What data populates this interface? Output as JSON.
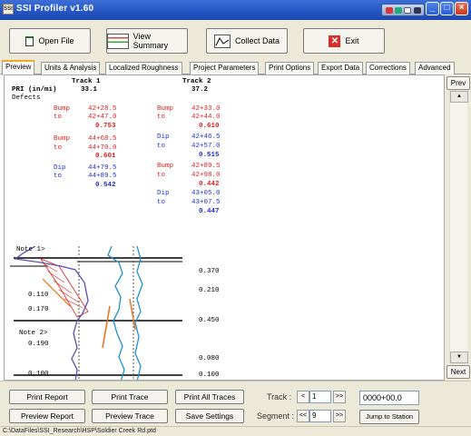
{
  "window": {
    "title": "SSI Profiler v1.60",
    "icon_text": "SSI"
  },
  "toolbar": {
    "open_label": "Open File",
    "view_label": "View Summary",
    "collect_label": "Collect Data",
    "exit_label": "Exit"
  },
  "tabs": [
    {
      "label": "Preview"
    },
    {
      "label": "Units & Analysis"
    },
    {
      "label": "Localized Roughness"
    },
    {
      "label": "Project Parameters"
    },
    {
      "label": "Print Options"
    },
    {
      "label": "Export Data"
    },
    {
      "label": "Corrections"
    },
    {
      "label": "Advanced"
    }
  ],
  "report": {
    "track1_header": "Track 1",
    "track2_header": "Track 2",
    "pri_label": "PRI (in/mi)",
    "track1_pri": "33.1",
    "track2_pri": "37.2",
    "defects_label": "Defects",
    "track1_defects": [
      {
        "type": "Bump",
        "from": "42+28.5",
        "to": "42+47.0",
        "value": "0.753"
      },
      {
        "type": "Bump",
        "from": "44+68.5",
        "to": "44+70.0",
        "value": "0.601"
      },
      {
        "type": "Dip",
        "from": "44+79.5",
        "to": "44+89.5",
        "value": "0.542"
      }
    ],
    "track2_defects": [
      {
        "type": "Bump",
        "from": "42+33.0",
        "to": "42+44.0",
        "value": "0.610"
      },
      {
        "type": "Dip",
        "from": "42+46.5",
        "to": "42+57.0",
        "value": "0.515"
      },
      {
        "type": "Bump",
        "from": "42+89.5",
        "to": "42+98.0",
        "value": "0.442"
      },
      {
        "type": "Dip",
        "from": "43+05.0",
        "to": "43+07.5",
        "value": "0.447"
      }
    ],
    "to_label": "to"
  },
  "trace": {
    "note1": "Note 1>",
    "note2": "Note 2>",
    "left_values": [
      "0.110",
      "0.170",
      "0.190",
      "0.100"
    ],
    "right_values": [
      "0.370",
      "0.210",
      "0.450",
      "0.080",
      "0.100"
    ]
  },
  "nav": {
    "prev_label": "Prev",
    "next_label": "Next"
  },
  "bottom": {
    "print_report": "Print Report",
    "print_trace": "Print Trace",
    "print_all_traces": "Print All Traces",
    "preview_report": "Preview Report",
    "preview_trace": "Preview Trace",
    "save_settings": "Save Settings",
    "track_label": "Track :",
    "track_value": "1",
    "segment_label": "Segment :",
    "segment_value": "9",
    "station_value": "0000+00.0",
    "jump_label": "Jump to Station"
  },
  "status": {
    "path": "C:\\DataFiles\\SSI_Research\\HSP\\Soldier Creek Rd.ptd"
  },
  "colors": {
    "bump": "#e02020",
    "dip": "#2030d0",
    "profile_blue": "#1e8fd0",
    "profile_purple": "#5a4fb0",
    "marker_orange": "#e8701a"
  }
}
